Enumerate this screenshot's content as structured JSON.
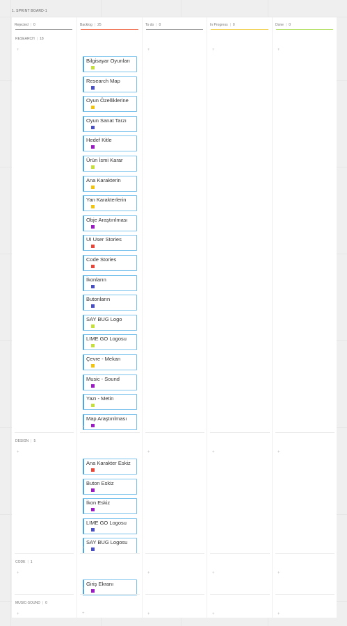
{
  "frame_title": "1. SPRINT BOARD-1",
  "columns": [
    {
      "name": "Rejected",
      "count": "0",
      "color": "#a0a0a0"
    },
    {
      "name": "Backlog",
      "count": "25",
      "color": "#f0795b"
    },
    {
      "name": "To do",
      "count": "0",
      "color": "#a0a0a0"
    },
    {
      "name": "In Progress",
      "count": "0",
      "color": "#f1d25a"
    },
    {
      "name": "Done",
      "count": "0",
      "color": "#b7e36c"
    }
  ],
  "lanes": [
    {
      "name": "RESEARCH",
      "count": "18",
      "cards": [
        {
          "title": "Bilgisayar Oyunları",
          "tag": "#c6e03b"
        },
        {
          "title": "Research Map",
          "tag": "#4b4fc4"
        },
        {
          "title": "Oyun Özelliklerine",
          "tag": "#f1c40f"
        },
        {
          "title": "Oyun Sanat Tarzı",
          "tag": "#4b4fc4"
        },
        {
          "title": "Hedef Kitle",
          "tag": "#9b1cc4"
        },
        {
          "title": "Ürün İsmi Karar",
          "tag": "#c6e03b"
        },
        {
          "title": "Ana Karakterin",
          "tag": "#f1c40f"
        },
        {
          "title": "Yan Karakterlerin",
          "tag": "#f1c40f"
        },
        {
          "title": "Obje Araştırılması",
          "tag": "#9b1cc4"
        },
        {
          "title": "UI User Stories",
          "tag": "#e8473a"
        },
        {
          "title": "Code Stories",
          "tag": "#e8473a"
        },
        {
          "title": "İkonların",
          "tag": "#4b4fc4"
        },
        {
          "title": "Butonların",
          "tag": "#4b4fc4"
        },
        {
          "title": "SAY BUG Logo",
          "tag": "#c6e03b"
        },
        {
          "title": "LIME GO Logosu",
          "tag": "#c6e03b"
        },
        {
          "title": "Çevre - Mekan",
          "tag": "#f1c40f"
        },
        {
          "title": "Music - Sound",
          "tag": "#9b1cc4"
        },
        {
          "title": "Yazı - Metin",
          "tag": "#c6e03b"
        },
        {
          "title": "Map Araştırılması",
          "tag": "#9b1cc4"
        }
      ]
    },
    {
      "name": "DESIGN",
      "count": "5",
      "cards": [
        {
          "title": "Ana Karakter Eskiz",
          "tag": "#e8473a"
        },
        {
          "title": "Buton Eskiz",
          "tag": "#9b1cc4"
        },
        {
          "title": "İkon Eskiz",
          "tag": "#9b1cc4"
        },
        {
          "title": "LIME GO Logosu",
          "tag": "#4b4fc4"
        },
        {
          "title": "SAY BUG Logosu",
          "tag": "#4b4fc4"
        }
      ]
    },
    {
      "name": "CODE",
      "count": "1",
      "cards": [
        {
          "title": "Giriş Ekranı",
          "tag": "#9b1cc4"
        }
      ]
    },
    {
      "name": "MUSIC-SOUND",
      "count": "0",
      "cards": []
    }
  ],
  "add_symbol": "+"
}
